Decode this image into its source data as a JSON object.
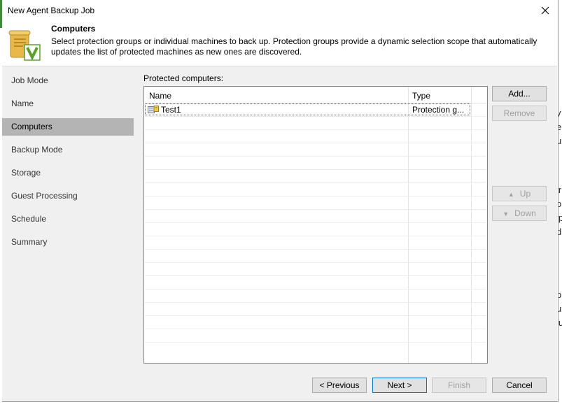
{
  "dialog": {
    "title": "New Agent Backup Job"
  },
  "header": {
    "title": "Computers",
    "description": "Select protection groups or individual machines to back up. Protection groups provide a dynamic selection scope that automatically updates the list of protected machines as new ones are discovered."
  },
  "sidebar": {
    "items": [
      {
        "label": "Job Mode"
      },
      {
        "label": "Name"
      },
      {
        "label": "Computers"
      },
      {
        "label": "Backup Mode"
      },
      {
        "label": "Storage"
      },
      {
        "label": "Guest Processing"
      },
      {
        "label": "Schedule"
      },
      {
        "label": "Summary"
      }
    ],
    "active": "Computers"
  },
  "main": {
    "label": "Protected computers:",
    "columns": [
      "Name",
      "Type"
    ],
    "rows": [
      {
        "name": "Test1",
        "type": "Protection g..."
      }
    ],
    "buttons": {
      "add": "Add...",
      "remove": "Remove",
      "up": "Up",
      "down": "Down"
    }
  },
  "footer": {
    "previous": "< Previous",
    "next": "Next >",
    "finish": "Finish",
    "cancel": "Cancel"
  },
  "background_fragments": [
    "y",
    "e",
    "u",
    "ir",
    "o",
    "ip",
    "d",
    "p",
    "u",
    "lu"
  ],
  "colors": {
    "accent": "#0078d7",
    "selected": "#b4b4b4",
    "panel": "#f0f0f0"
  }
}
